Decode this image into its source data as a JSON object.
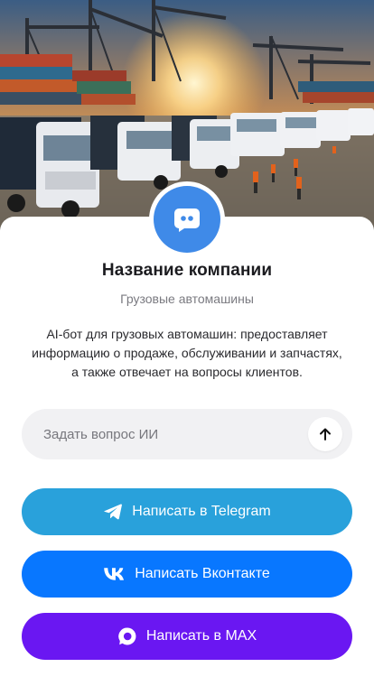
{
  "hero": {
    "icon": "truck-terminal-photo"
  },
  "profile": {
    "avatar_icon": "chat-bot-icon",
    "company_name": "Название компании",
    "category": "Грузовые автомашины",
    "description": "AI-бот для грузовых автомашин: предоставляет информацию о продаже, обслуживании и запчастях, а также отвечает на вопросы клиентов."
  },
  "ask": {
    "placeholder": "Задать вопрос ИИ",
    "value": "",
    "send_icon": "arrow-up-icon"
  },
  "actions": [
    {
      "label": "Написать в Telegram",
      "icon": "telegram-icon",
      "color": "#29a1db"
    },
    {
      "label": "Написать Вконтакте",
      "icon": "vk-icon",
      "color": "#0877ff"
    },
    {
      "label": "Написать в MAX",
      "icon": "max-icon",
      "color": "#6a17f2"
    }
  ],
  "colors": {
    "accent": "#3f8ae8",
    "background": "#ffffff",
    "input_bg": "#f1f1f3"
  }
}
